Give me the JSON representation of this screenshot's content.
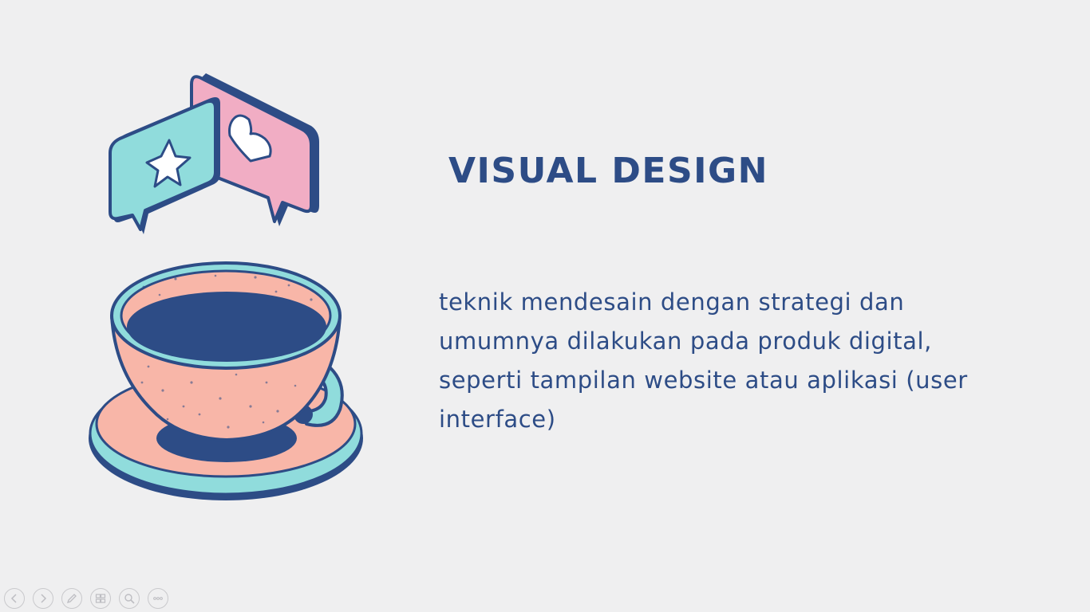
{
  "slide": {
    "title": "VISUAL DESIGN",
    "body": "teknik mendesain dengan strategi dan umumnya dilakukan pada produk digital, seperti tampilan website atau aplikasi (user interface)"
  },
  "illustration": {
    "icons": [
      "star-chat-bubble-icon",
      "heart-chat-bubble-icon",
      "coffee-cup-icon"
    ]
  },
  "controls": {
    "icons": [
      "previous-icon",
      "next-icon",
      "pen-icon",
      "slides-icon",
      "zoom-icon",
      "more-icon"
    ]
  },
  "colors": {
    "background": "#efeff0",
    "text": "#2d4c86",
    "pink": "#f1adc4",
    "teal": "#90dcdc",
    "peach": "#f8b6a8",
    "navy": "#2d4c86"
  }
}
